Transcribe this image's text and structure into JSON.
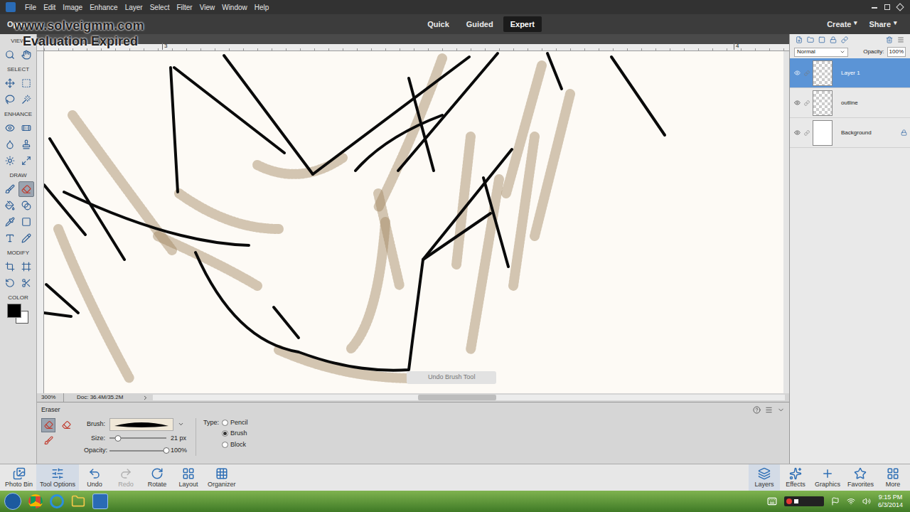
{
  "watermark": {
    "lines": [
      "www.solveigmm.com",
      "Evaluation Expired"
    ]
  },
  "menu": [
    "File",
    "Edit",
    "Image",
    "Enhance",
    "Layer",
    "Select",
    "Filter",
    "View",
    "Window",
    "Help"
  ],
  "open_button": "Open",
  "modes": [
    {
      "label": "Quick",
      "selected": false
    },
    {
      "label": "Guided",
      "selected": false
    },
    {
      "label": "Expert",
      "selected": true
    }
  ],
  "header_actions": [
    {
      "label": "Create",
      "arrow": "▾"
    },
    {
      "label": "Share",
      "arrow": "▾"
    }
  ],
  "toolbox": {
    "sections": [
      {
        "label": "VIEW",
        "tools": [
          {
            "selected": false
          },
          {
            "selected": false
          }
        ]
      },
      {
        "label": "SELECT",
        "tools": [
          {
            "selected": false
          },
          {
            "selected": false
          },
          {
            "selected": false
          },
          {
            "selected": false
          }
        ]
      },
      {
        "label": "ENHANCE",
        "tools": [
          {
            "selected": false
          },
          {
            "selected": false
          },
          {
            "selected": false
          },
          {
            "selected": false
          },
          {
            "selected": false
          },
          {
            "selected": false
          }
        ]
      },
      {
        "label": "DRAW",
        "tools": [
          {
            "selected": false
          },
          {
            "selected": true
          },
          {
            "selected": false
          },
          {
            "selected": false
          },
          {
            "selected": false
          },
          {
            "selected": false
          },
          {
            "selected": false
          },
          {
            "selected": false
          }
        ]
      },
      {
        "label": "MODIFY",
        "tools": [
          {
            "selected": false
          },
          {
            "selected": false
          },
          {
            "selected": false
          },
          {
            "selected": false
          }
        ]
      }
    ],
    "color_label": "COLOR",
    "foreground": "#000000",
    "background": "#ffffff"
  },
  "document": {
    "ruler_marks": [
      "3",
      "4"
    ],
    "zoom": "300%",
    "doc_size": "Doc: 36.4M/35.2M",
    "tooltip": "Undo Brush Tool",
    "scroll_level": 0.42
  },
  "tool_options": {
    "title": "Eraser",
    "variants": [
      {
        "selected": true
      },
      {
        "selected": false
      },
      {
        "selected": false
      }
    ],
    "brush_label": "Brush:",
    "size": {
      "label": "Size:",
      "level": 0.15,
      "reading": "21 px"
    },
    "opacity": {
      "label": "Opacity:",
      "level": 1,
      "reading": "100%"
    },
    "type_label": "Type:",
    "types": [
      {
        "label": "Pencil",
        "selected": false
      },
      {
        "label": "Brush",
        "selected": true
      },
      {
        "label": "Block",
        "selected": false
      }
    ]
  },
  "layers_panel": {
    "blend_mode": "Normal",
    "opacity_label": "Opacity:",
    "opacity": "100%",
    "layers": [
      {
        "name": "Layer 1",
        "selected": true,
        "visible": true,
        "locked": false,
        "kind": "transparent"
      },
      {
        "name": "outline",
        "selected": false,
        "visible": true,
        "locked": false,
        "kind": "transparent"
      },
      {
        "name": "Background",
        "selected": false,
        "visible": true,
        "locked": true,
        "kind": "background"
      }
    ]
  },
  "bottom_bar": {
    "left": [
      {
        "label": "Photo Bin",
        "selected": false,
        "disabled": false
      },
      {
        "label": "Tool Options",
        "selected": true,
        "disabled": false
      },
      {
        "label": "Undo",
        "selected": false,
        "disabled": false
      },
      {
        "label": "Redo",
        "selected": false,
        "disabled": true
      },
      {
        "label": "Rotate",
        "selected": false,
        "disabled": false
      },
      {
        "label": "Layout",
        "selected": false,
        "disabled": false
      },
      {
        "label": "Organizer",
        "selected": false,
        "disabled": false
      }
    ],
    "right": [
      {
        "label": "Layers",
        "selected": true,
        "disabled": false
      },
      {
        "label": "Effects",
        "selected": false,
        "disabled": false
      },
      {
        "label": "Graphics",
        "selected": false,
        "disabled": false
      },
      {
        "label": "Favorites",
        "selected": false,
        "disabled": false
      },
      {
        "label": "More",
        "selected": false,
        "disabled": false
      }
    ]
  },
  "taskbar": {
    "time": "9:15 PM",
    "date": "6/3/2014"
  }
}
